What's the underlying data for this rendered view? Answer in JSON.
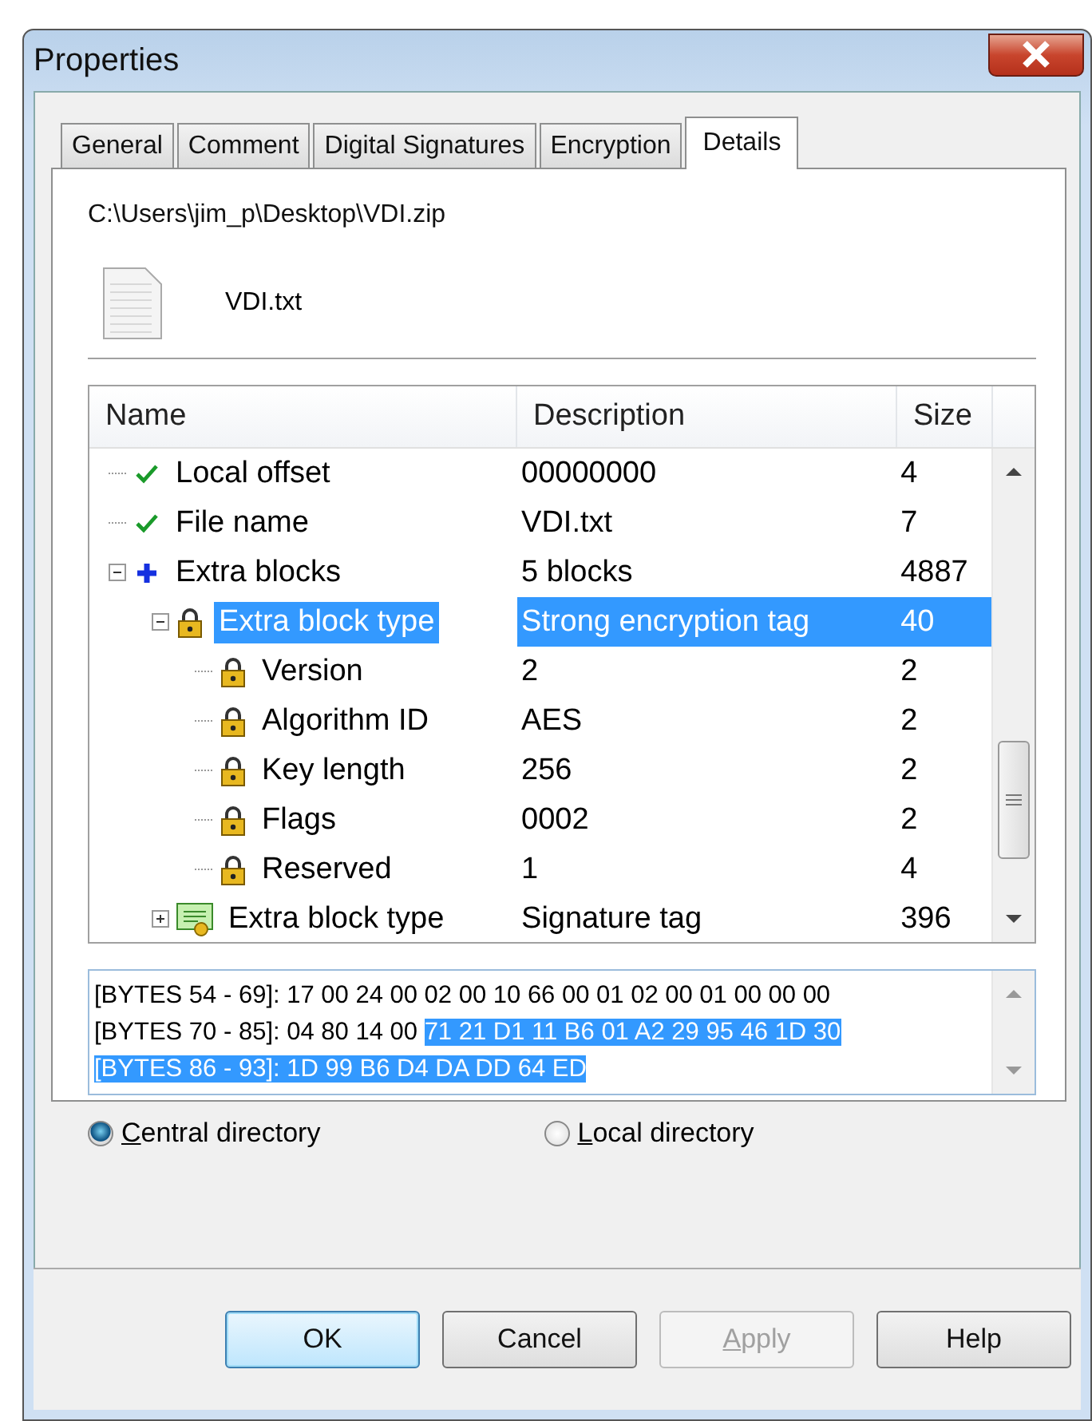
{
  "window": {
    "title": "Properties"
  },
  "tabs": [
    {
      "label": "General",
      "selected": false
    },
    {
      "label": "Comment",
      "selected": false
    },
    {
      "label": "Digital Signatures",
      "selected": false
    },
    {
      "label": "Encryption",
      "selected": false
    },
    {
      "label": "Details",
      "selected": true
    }
  ],
  "path": "C:\\Users\\jim_p\\Desktop\\VDI.zip",
  "file_name": "VDI.txt",
  "tree": {
    "columns": [
      "Name",
      "Description",
      "Size"
    ],
    "rows": [
      {
        "kind": "check",
        "name": "Local offset",
        "description": "00000000",
        "size": "4",
        "selected": false
      },
      {
        "kind": "check",
        "name": "File name",
        "description": "VDI.txt",
        "size": "7",
        "selected": false
      },
      {
        "kind": "plus",
        "name": "Extra blocks",
        "description": "5 blocks",
        "size": "4887",
        "selected": false,
        "expanded": true,
        "children": [
          {
            "kind": "lock",
            "name": "Extra block type",
            "description": "Strong encryption tag",
            "size": "40",
            "selected": true,
            "expanded": true,
            "children": [
              {
                "kind": "lock",
                "name": "Version",
                "description": "2",
                "size": "2",
                "selected": false
              },
              {
                "kind": "lock",
                "name": "Algorithm ID",
                "description": "AES",
                "size": "2",
                "selected": false
              },
              {
                "kind": "lock",
                "name": "Key length",
                "description": "256",
                "size": "2",
                "selected": false
              },
              {
                "kind": "lock",
                "name": "Flags",
                "description": "0002",
                "size": "2",
                "selected": false
              },
              {
                "kind": "lock",
                "name": "Reserved",
                "description": "1",
                "size": "4",
                "selected": false
              }
            ]
          },
          {
            "kind": "certificate",
            "name": "Extra block type",
            "description": "Signature tag",
            "size": "396",
            "selected": false,
            "expanded": false
          }
        ]
      }
    ]
  },
  "hex_lines": [
    [
      {
        "text": "[BYTES 54 - 69]: 17 00 24 00 02 00 10 66 00 01 02 00 01 00 00 00",
        "selected": false
      }
    ],
    [
      {
        "text": "[BYTES 70 - 85]: 04 80 14 00 ",
        "selected": false
      },
      {
        "text": "71 21 D1 11 B6 01 A2 29 95 46 1D 30",
        "selected": true
      }
    ],
    [
      {
        "text": "[BYTES 86 - 93]: 1D 99 B6 D4 DA DD 64 ED",
        "selected": true
      }
    ]
  ],
  "radios": [
    {
      "label": "Central directory",
      "selected": true,
      "mnemonic": true
    },
    {
      "label": "Local directory",
      "selected": false,
      "mnemonic": true
    }
  ],
  "buttons": [
    {
      "label": "OK",
      "default": true,
      "disabled": false,
      "mnemonic": false
    },
    {
      "label": "Cancel",
      "default": false,
      "disabled": false,
      "mnemonic": false
    },
    {
      "label": "Apply",
      "default": false,
      "disabled": true,
      "mnemonic": true
    },
    {
      "label": "Help",
      "default": false,
      "disabled": false,
      "mnemonic": false
    }
  ]
}
